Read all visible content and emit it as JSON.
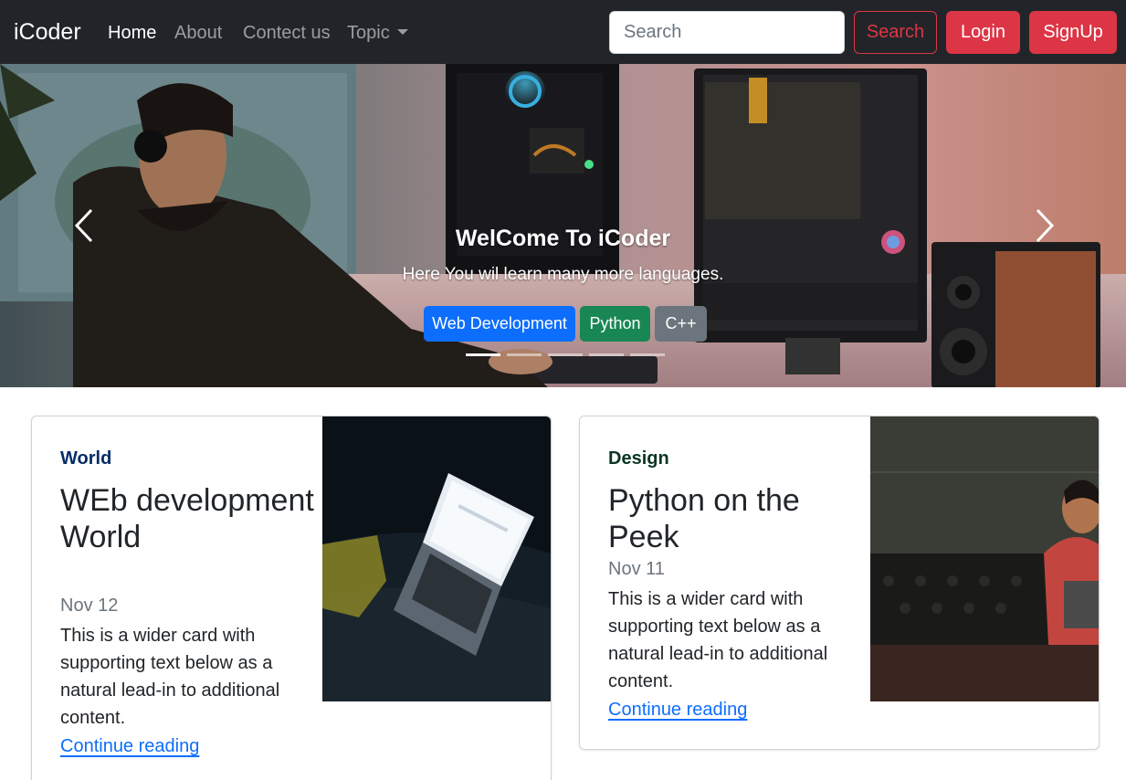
{
  "navbar": {
    "brand": "iCoder",
    "links": [
      "Home",
      "About",
      "Contect us",
      "Topic"
    ],
    "search_placeholder": "Search",
    "search_button": "Search",
    "login_button": "Login",
    "signup_button": "SignUp"
  },
  "carousel": {
    "title": "WelCome To iCoder",
    "subtitle": "Here You wil learn many more languages.",
    "buttons": [
      "Web Development",
      "Python",
      "C++"
    ],
    "slides": 5,
    "active_slide": 1
  },
  "cards": [
    {
      "category": "World",
      "title": "WEb development World",
      "date": "Nov 12",
      "text": "This is a wider card with supporting text below as a natural lead-in to additional content.",
      "link": "Continue reading"
    },
    {
      "category": "Design",
      "title": "Python on the Peek",
      "date": "Nov 11",
      "text": "This is a wider card with supporting text below as a natural lead-in to additional content.",
      "link": "Continue reading"
    }
  ],
  "colors": {
    "navbar_bg": "#212529",
    "danger": "#dc3545",
    "primary": "#0d6efd",
    "success": "#198754",
    "secondary": "#6c757d"
  }
}
